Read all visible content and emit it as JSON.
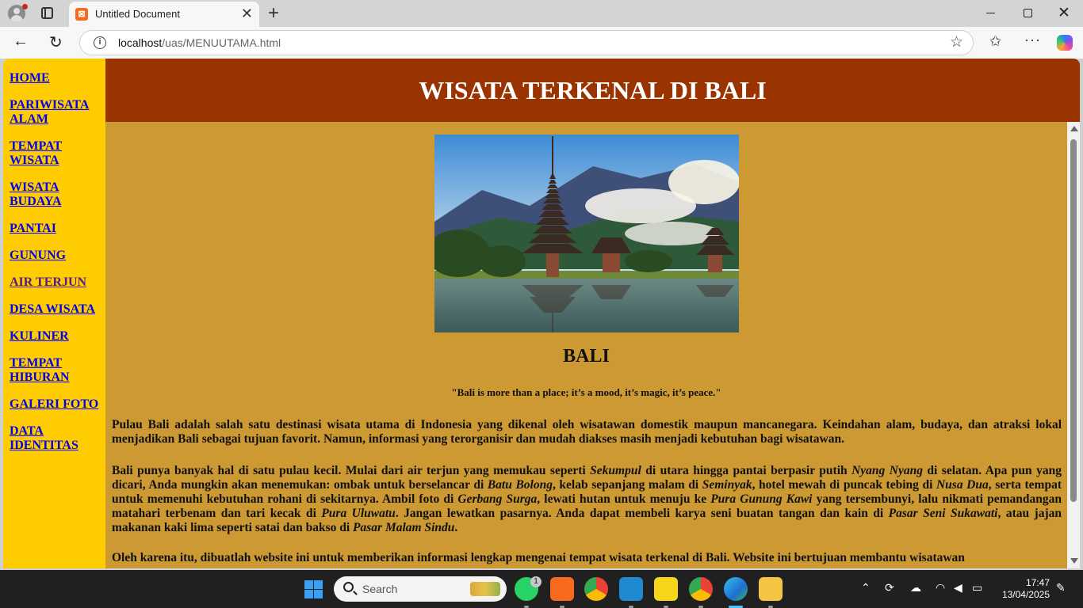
{
  "browser": {
    "tab_title": "Untitled Document",
    "tab_favicon": "xampp-icon",
    "url_host": "localhost",
    "url_path": "/uas/MENUUTAMA.html"
  },
  "sidebar": {
    "items": [
      {
        "label": "HOME",
        "visited": false
      },
      {
        "label": "PARIWISATA ALAM",
        "visited": false
      },
      {
        "label": "TEMPAT WISATA",
        "visited": false
      },
      {
        "label": "WISATA BUDAYA",
        "visited": false
      },
      {
        "label": "PANTAI",
        "visited": false
      },
      {
        "label": "GUNUNG",
        "visited": false
      },
      {
        "label": "AIR TERJUN",
        "visited": true
      },
      {
        "label": "DESA WISATA",
        "visited": false
      },
      {
        "label": "KULINER",
        "visited": false
      },
      {
        "label": "TEMPAT HIBURAN",
        "visited": false
      },
      {
        "label": "GALERI FOTO",
        "visited": false
      },
      {
        "label": "DATA IDENTITAS",
        "visited": false
      }
    ]
  },
  "header": {
    "title": "WISATA TERKENAL DI BALI"
  },
  "main": {
    "image_alt": "bali-temple-photo",
    "heading": "BALI",
    "quote": "\"Bali is more than a place; it’s a mood, it’s magic, it’s peace.\"",
    "paragraph1": "Pulau Bali adalah salah satu destinasi wisata utama di Indonesia yang dikenal oleh wisatawan domestik maupun mancanegara. Keindahan alam, budaya, dan atraksi lokal menjadikan Bali sebagai tujuan favorit. Namun, informasi yang terorganisir dan mudah diakses masih menjadi kebutuhan bagi wisatawan.",
    "paragraph2_segments": [
      {
        "text": "Bali punya banyak hal di satu pulau kecil. Mulai dari air terjun yang memukau seperti ",
        "italic": false
      },
      {
        "text": "Sekumpul",
        "italic": true
      },
      {
        "text": " di utara hingga pantai berpasir putih ",
        "italic": false
      },
      {
        "text": "Nyang Nyang",
        "italic": true
      },
      {
        "text": " di selatan. Apa pun yang dicari, Anda mungkin akan menemukan: ombak untuk berselancar di ",
        "italic": false
      },
      {
        "text": "Batu Bolong",
        "italic": true
      },
      {
        "text": ", kelab sepanjang malam di ",
        "italic": false
      },
      {
        "text": "Seminyak",
        "italic": true
      },
      {
        "text": ", hotel mewah di puncak tebing di ",
        "italic": false
      },
      {
        "text": "Nusa Dua",
        "italic": true
      },
      {
        "text": ", serta tempat untuk memenuhi kebutuhan rohani di sekitarnya. Ambil foto di ",
        "italic": false
      },
      {
        "text": "Gerbang Surga",
        "italic": true
      },
      {
        "text": ", lewati hutan untuk menuju ke ",
        "italic": false
      },
      {
        "text": "Pura Gunung Kawi",
        "italic": true
      },
      {
        "text": " yang tersembunyi, lalu nikmati pemandangan matahari terbenam dan tari kecak di ",
        "italic": false
      },
      {
        "text": "Pura Uluwatu",
        "italic": true
      },
      {
        "text": ". Jangan lewatkan pasarnya. Anda dapat membeli karya seni buatan tangan dan kain di ",
        "italic": false
      },
      {
        "text": "Pasar Seni Sukawati",
        "italic": true
      },
      {
        "text": ", atau jajan makanan kaki lima seperti satai dan bakso di ",
        "italic": false
      },
      {
        "text": "Pasar Malam Sindu",
        "italic": true
      },
      {
        "text": ".",
        "italic": false
      }
    ],
    "paragraph3": "Oleh karena itu, dibuatlah website ini untuk memberikan informasi lengkap mengenai tempat wisata terkenal di Bali. Website ini bertujuan membantu wisatawan"
  },
  "taskbar": {
    "search_placeholder": "Search",
    "whatsapp_badge": "1",
    "time": "17:47",
    "date": "13/04/2025"
  },
  "colors": {
    "sidebar_bg": "#ffcc00",
    "header_bg": "#993300",
    "content_bg": "#cc9933",
    "link": "#0000ee",
    "link_visited": "#551a8b"
  }
}
